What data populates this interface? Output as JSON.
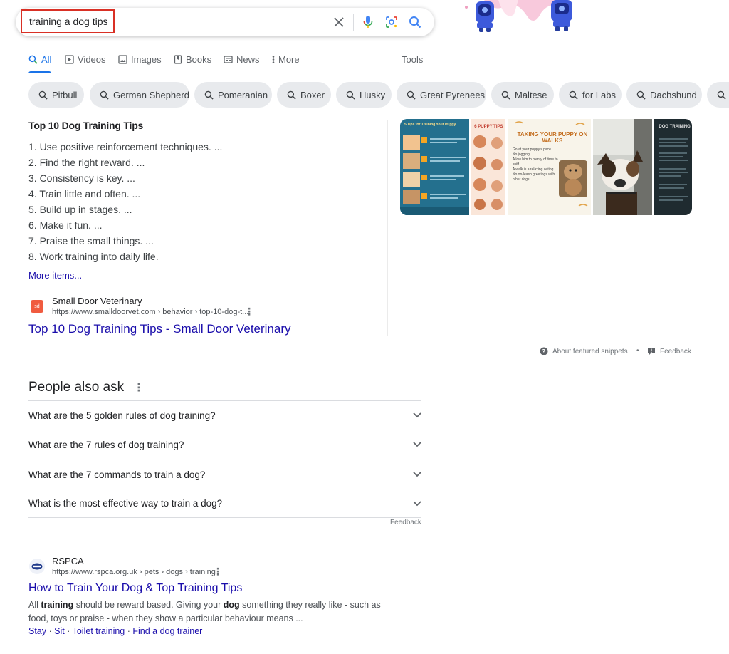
{
  "search": {
    "query": "training a dog tips"
  },
  "tabs": [
    {
      "label": "All",
      "icon": "search-icon"
    },
    {
      "label": "Videos",
      "icon": "play-icon"
    },
    {
      "label": "Images",
      "icon": "image-icon"
    },
    {
      "label": "Books",
      "icon": "book-icon"
    },
    {
      "label": "News",
      "icon": "news-icon"
    },
    {
      "label": "More",
      "icon": "kebab-icon"
    }
  ],
  "tools_label": "Tools",
  "chips": [
    "Pitbull",
    "German Shepherd",
    "Pomeranian",
    "Boxer",
    "Husky",
    "Great Pyrenees",
    "Maltese",
    "for Labs",
    "Dachshund"
  ],
  "featured": {
    "title": "Top 10 Dog Training Tips",
    "tips": [
      "1. Use positive reinforcement techniques. ...",
      "2. Find the right reward. ...",
      "3. Consistency is key. ...",
      "4. Train little and often. ...",
      "5. Build up in stages. ...",
      "6. Make it fun. ...",
      "7. Praise the small things. ...",
      "8. Work training into daily life."
    ],
    "more_items": "More items...",
    "source": {
      "favicon_text": "sd",
      "name": "Small Door Veterinary",
      "url": "https://www.smalldoorvet.com › behavior › top-10-dog-t...",
      "link_title": "Top 10 Dog Training Tips - Small Door Veterinary"
    },
    "images": {
      "img1_title": "5 Tips for Training Your Puppy",
      "img2_title": "6 PUPPY TIPS",
      "img3_title": "TAKING YOUR PUPPY ON WALKS",
      "img3_items": [
        "Go at your puppy's pace",
        "No jogging",
        "Allow him to plenty of time to sniff",
        "A walk is a relaxing outing",
        "No on-leash greetings with other dogs"
      ],
      "img4_title": "DOG TRAINING"
    },
    "about_label": "About featured snippets",
    "feedback_label": "Feedback"
  },
  "paa": {
    "title": "People also ask",
    "questions": [
      "What are the 5 golden rules of dog training?",
      "What are the 7 rules of dog training?",
      "What are the 7 commands to train a dog?",
      "What is the most effective way to train a dog?"
    ],
    "feedback_label": "Feedback"
  },
  "result2": {
    "name": "RSPCA",
    "url": "https://www.rspca.org.uk › pets › dogs › training",
    "title": "How to Train Your Dog & Top Training Tips",
    "snippet_parts": [
      "All ",
      "training",
      " should be reward based. Giving your ",
      "dog",
      " something they really like - such as food, toys or praise - when they show a particular behaviour means ..."
    ],
    "sitelinks": [
      "Stay",
      "Sit",
      "Toilet training",
      "Find a dog trainer"
    ],
    "separator": " · "
  },
  "colors": {
    "accent": "#1a73e8",
    "link": "#1a0dab",
    "highlight_box": "#d93025"
  }
}
